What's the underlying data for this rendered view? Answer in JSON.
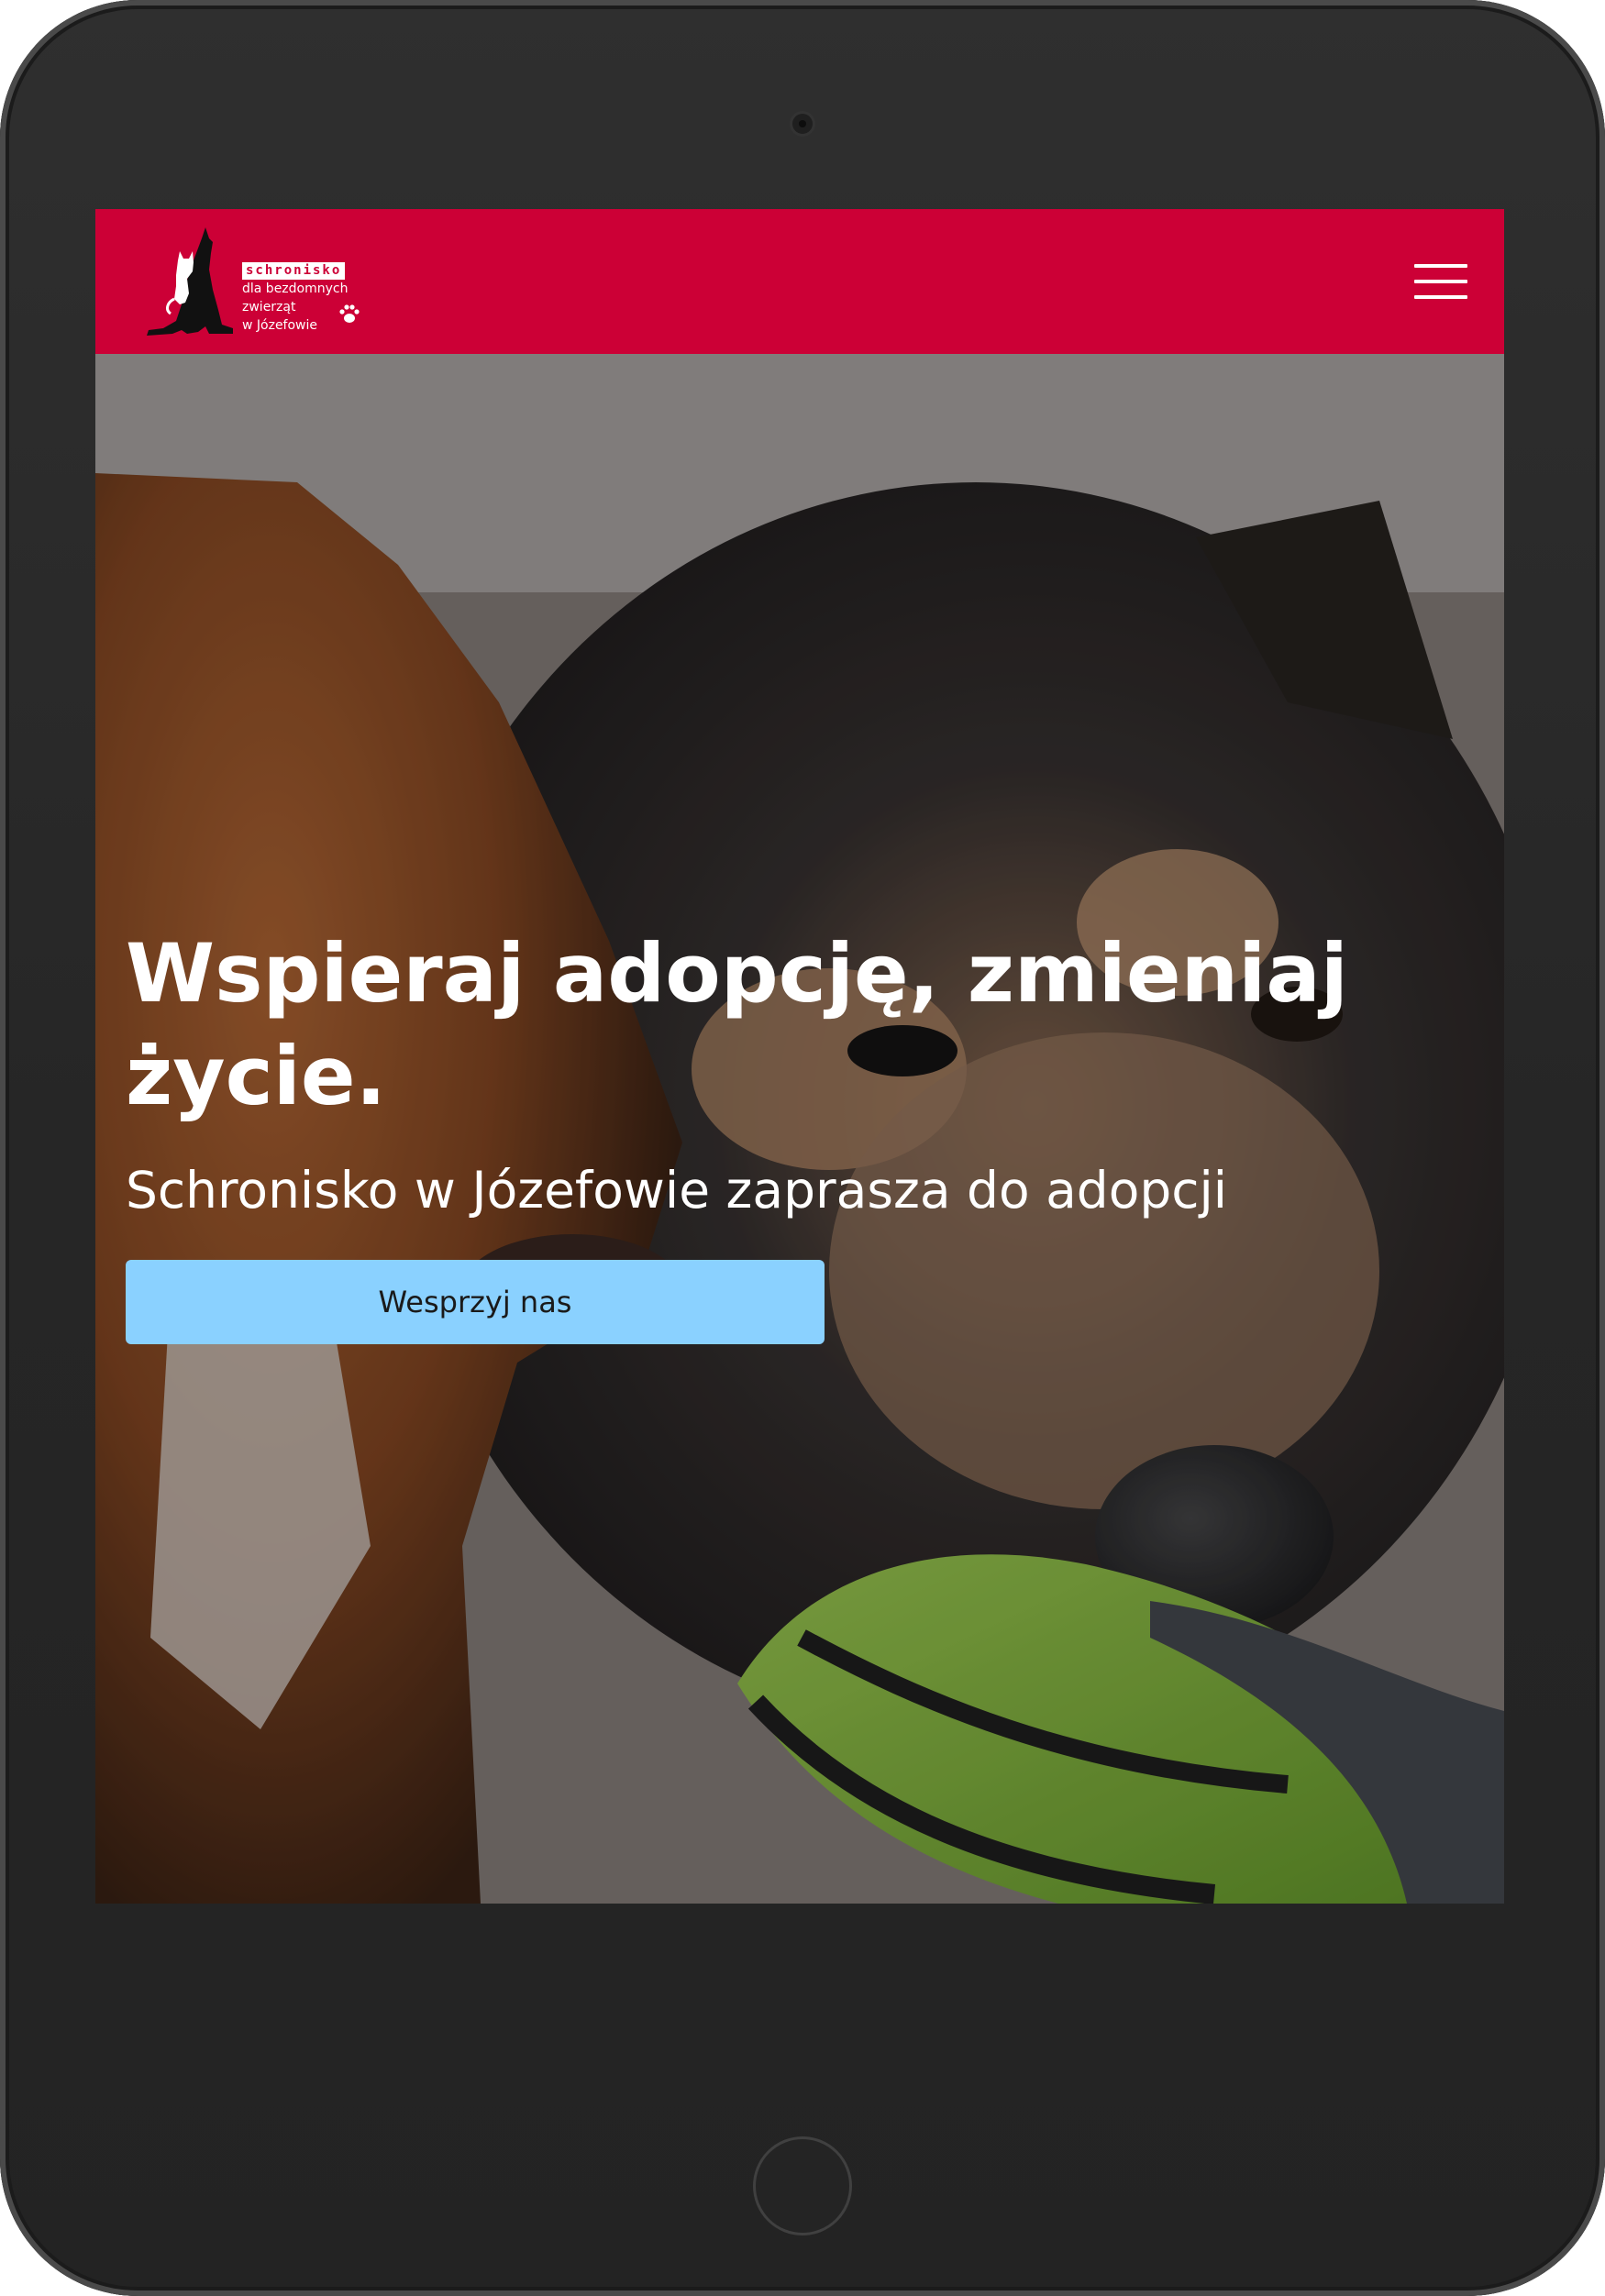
{
  "header": {
    "logo": {
      "title": "schronisko",
      "lines": [
        "dla bezdomnych",
        "zwierząt",
        "w Józefowie"
      ],
      "mark_icon": "dog-cat-silhouette-icon",
      "paw_icon": "paw-icon"
    },
    "menu_icon": "hamburger-menu-icon",
    "background_color": "#cc0036"
  },
  "hero": {
    "title": "Wspieraj adopcję, zmieniaj życie.",
    "subtitle": "Schronisko w Józefowie zaprasza do adopcji",
    "cta_label": "Wesprzyj nas",
    "cta_color": "#8ad1ff",
    "image_alt": "two-dogs-playing-with-green-toy"
  }
}
